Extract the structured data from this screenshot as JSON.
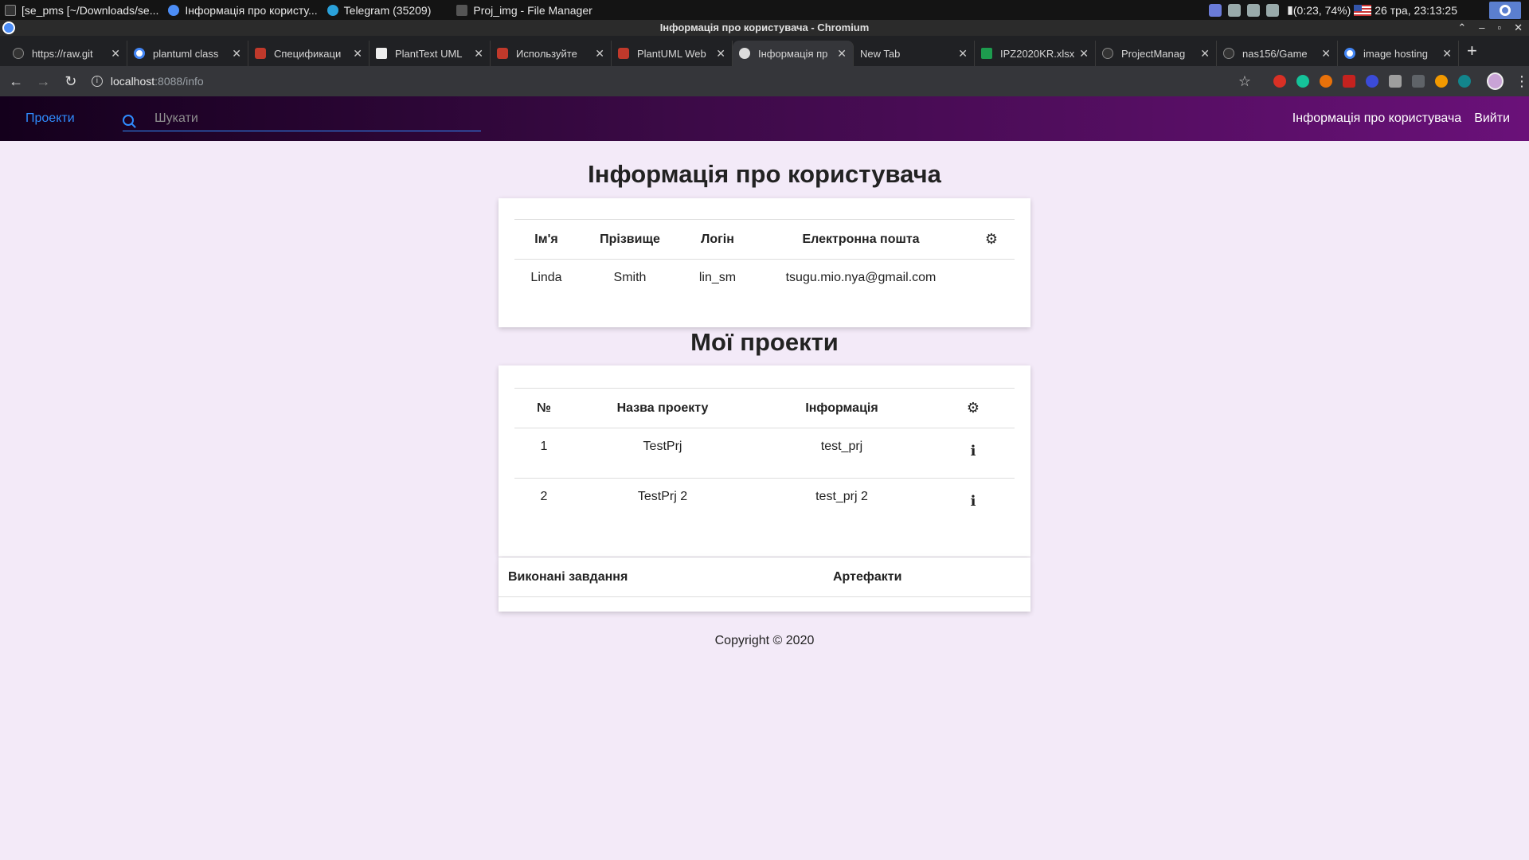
{
  "taskbar": {
    "apps": [
      {
        "label": "[se_pms [~/Downloads/se..."
      },
      {
        "label": "Інформація про користу..."
      },
      {
        "label": "Telegram (35209)"
      },
      {
        "label": "Proj_img - File Manager"
      }
    ],
    "battery": "(0:23, 74%)",
    "datetime": "26 тра, 23:13:25"
  },
  "window": {
    "title": "Інформація про користувача - Chromium"
  },
  "browser": {
    "tabs": [
      {
        "label": "https://raw.git",
        "icon": "github-icon"
      },
      {
        "label": "plantuml class",
        "icon": "google-icon"
      },
      {
        "label": "Спецификаци",
        "icon": "plantuml-icon"
      },
      {
        "label": "PlantText UML",
        "icon": "planttext-icon"
      },
      {
        "label": "Используйте",
        "icon": "plantuml-icon"
      },
      {
        "label": "PlantUML Web",
        "icon": "plantuml-icon"
      },
      {
        "label": "Інформація пр",
        "icon": "globe-icon",
        "active": true
      },
      {
        "label": "New Tab",
        "icon": ""
      },
      {
        "label": "IPZ2020KR.xlsx",
        "icon": "excel-icon"
      },
      {
        "label": "ProjectManag",
        "icon": "github-icon"
      },
      {
        "label": "nas156/Game",
        "icon": "github-icon"
      },
      {
        "label": "image hosting",
        "icon": "google-icon"
      }
    ],
    "url_host": "localhost",
    "url_path": ":8088/info"
  },
  "navbar": {
    "brand": "Проекти",
    "search_placeholder": "Шукати",
    "user_info_link": "Інформація про користувача",
    "logout_link": "Вийти"
  },
  "user_section": {
    "title": "Інформація про користувача",
    "headers": [
      "Ім'я",
      "Прізвище",
      "Логін",
      "Електронна пошта"
    ],
    "user": {
      "first_name": "Linda",
      "last_name": "Smith",
      "login": "lin_sm",
      "email": "tsugu.mio.nya@gmail.com"
    }
  },
  "projects_section": {
    "title": "Мої проекти",
    "headers": [
      "№",
      "Назва проекту",
      "Інформація"
    ],
    "rows": [
      {
        "num": "1",
        "name": "TestPrj",
        "info": "test_prj"
      },
      {
        "num": "2",
        "name": "TestPrj 2",
        "info": "test_prj 2"
      }
    ]
  },
  "tasks_section": {
    "col1": "Виконані завдання",
    "col2": "Артефакти"
  },
  "footer": {
    "text": "Copyright © 2020"
  }
}
